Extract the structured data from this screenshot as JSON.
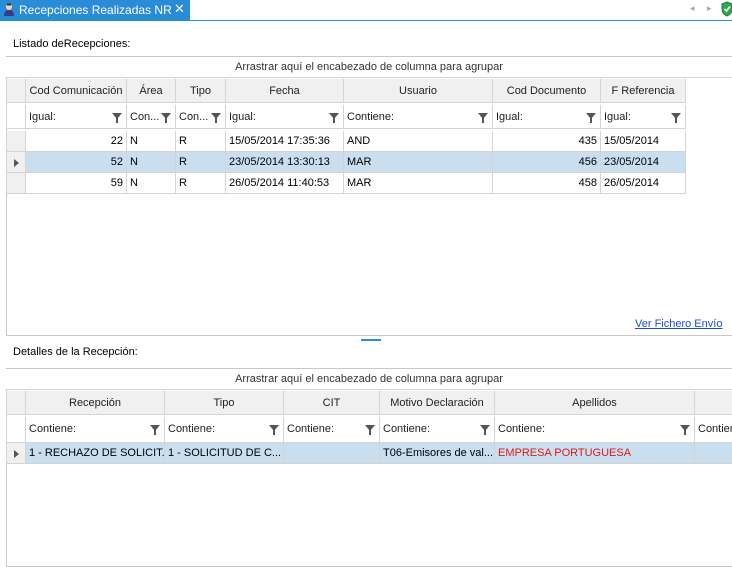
{
  "tab": {
    "title": "Recepciones Realizadas NR",
    "close": "✕"
  },
  "nav": {
    "prev": "◂",
    "next": "▸"
  },
  "top": {
    "section_label": "Listado deRecepciones:",
    "group_hint": "Arrastrar aquí el encabezado de columna para agrupar",
    "columns": [
      "Cod Comunicación",
      "Área",
      "Tipo",
      "Fecha",
      "Usuario",
      "Cod Documento",
      "F Referencia"
    ],
    "filters": [
      "Igual:",
      "Con...",
      "Con...",
      "Igual:",
      "Contiene:",
      "Igual:",
      "Igual:"
    ],
    "rows": [
      [
        "22",
        "N",
        "R",
        "15/05/2014 17:35:36",
        "AND",
        "435",
        "15/05/2014"
      ],
      [
        "52",
        "N",
        "R",
        "23/05/2014 13:30:13",
        "MAR",
        "456",
        "23/05/2014"
      ],
      [
        "59",
        "N",
        "R",
        "26/05/2014 11:40:53",
        "MAR",
        "458",
        "26/05/2014"
      ]
    ],
    "selected_row": 1,
    "link": "Ver Fichero Envío"
  },
  "bottom": {
    "section_label": "Detalles de la Recepción:",
    "group_hint": "Arrastrar aquí el encabezado de columna para agrupar",
    "columns": [
      "Recepción",
      "Tipo",
      "CIT",
      "Motivo Declaración",
      "Apellidos",
      ""
    ],
    "filters": [
      "Contiene:",
      "Contiene:",
      "Contiene:",
      "Contiene:",
      "Contiene:",
      "Contien"
    ],
    "rows": [
      [
        "1 - RECHAZO DE SOLICIT...",
        "1 - SOLICITUD DE C...",
        "",
        "T06-Emisores de val...",
        "EMPRESA PORTUGUESA",
        ""
      ]
    ],
    "colors": {
      "apellidos_text": "#e01818",
      "selection": "#c9dff0",
      "accent": "#2a8bd6"
    }
  }
}
